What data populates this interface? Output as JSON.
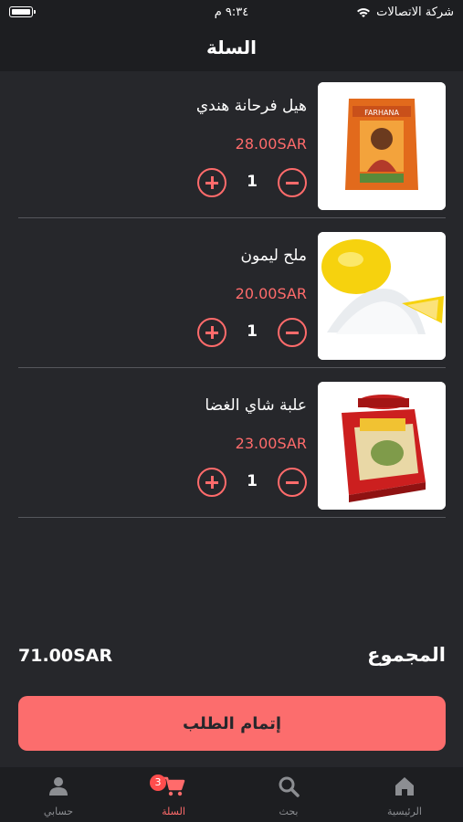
{
  "status": {
    "carrier": "شركة الاتصالات",
    "time": "٩:٣٤ م"
  },
  "header": {
    "title": "السلة"
  },
  "cart": {
    "items": [
      {
        "name": "هيل فرحانة هندي",
        "price": "28.00SAR",
        "quantity": "1"
      },
      {
        "name": "ملح ليمون",
        "price": "20.00SAR",
        "quantity": "1"
      },
      {
        "name": "علبة شاي الغضا",
        "price": "23.00SAR",
        "quantity": "1"
      }
    ]
  },
  "summary": {
    "total_label": "المجموع",
    "total_value": "71.00SAR"
  },
  "checkout": {
    "label": "إتمام الطلب"
  },
  "tabbar": {
    "home": "الرئيسية",
    "search": "بحث",
    "cart": "السلة",
    "cart_badge": "3",
    "account": "حسابي"
  },
  "colors": {
    "accent": "#fc6d6d",
    "background": "#26272b",
    "bar": "#1d1e21"
  }
}
